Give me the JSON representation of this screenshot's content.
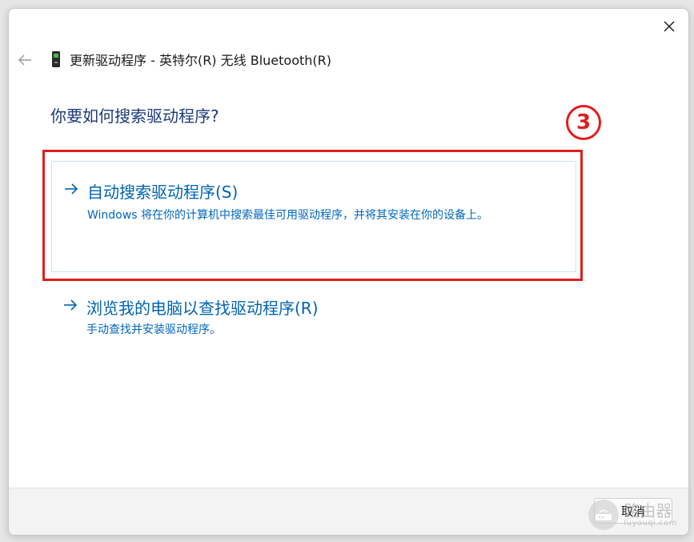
{
  "window": {
    "title": "更新驱动程序 - 英特尔(R) 无线 Bluetooth(R)",
    "close_icon": "close-icon",
    "back_icon": "back-arrow-icon",
    "device_icon": "usb-device-icon"
  },
  "main": {
    "heading": "你要如何搜索驱动程序?",
    "step_badge": "3",
    "options": [
      {
        "title": "自动搜索驱动程序(S)",
        "description": "Windows 将在你的计算机中搜索最佳可用驱动程序，并将其安装在你的设备上。",
        "icon": "arrow-right-icon"
      },
      {
        "title": "浏览我的电脑以查找驱动程序(R)",
        "description": "手动查找并安装驱动程序。",
        "icon": "arrow-right-icon"
      }
    ]
  },
  "footer": {
    "cancel_label": "取消"
  },
  "watermark": {
    "text": "路由器",
    "sub": "luyouqi.com"
  },
  "colors": {
    "accent": "#0067c0",
    "heading": "#1a3a7a",
    "highlight": "#e21d1d"
  }
}
